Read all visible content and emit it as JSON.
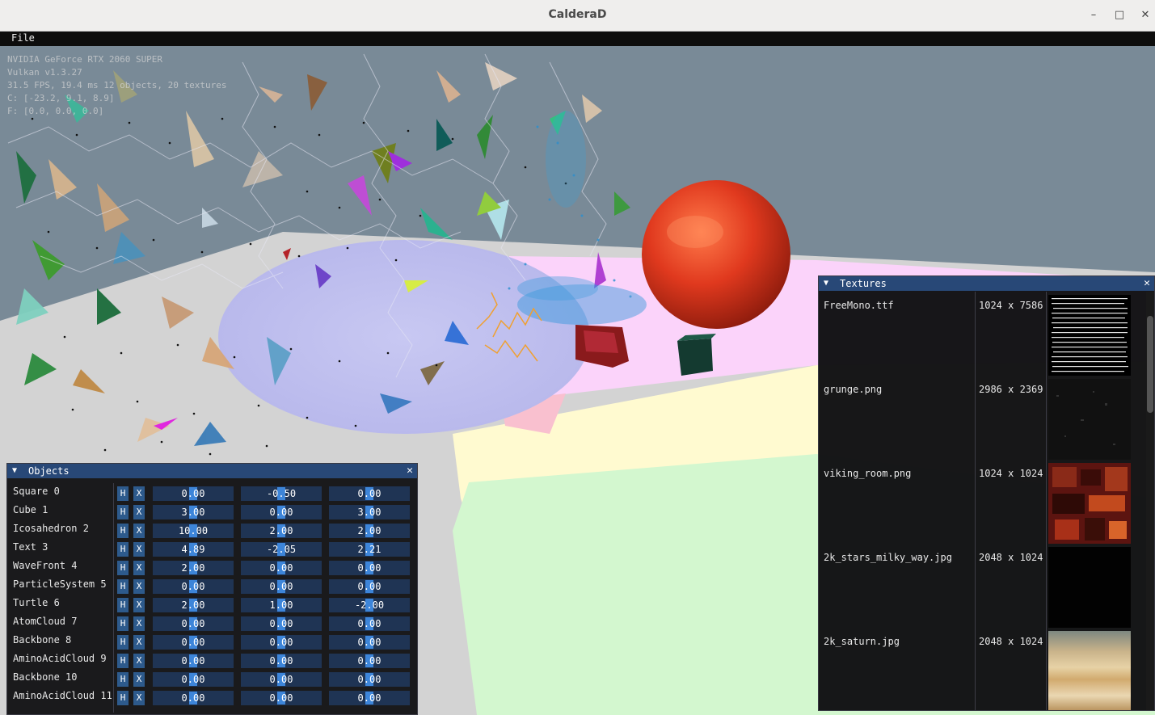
{
  "window": {
    "title": "CalderaD",
    "minimize_glyph": "–",
    "maximize_glyph": "□",
    "close_glyph": "✕"
  },
  "menu": {
    "file_label": "File"
  },
  "overlay": {
    "gpu": "NVIDIA GeForce RTX 2060 SUPER",
    "api": "Vulkan v1.3.27",
    "stats": "31.5 FPS, 19.4 ms 12 objects, 20 textures",
    "camera": "C: [-23.2, 9.1, 8.9]",
    "focus": "F: [0.0, 0.0, 0.0]"
  },
  "objects_panel": {
    "title": "Objects",
    "collapse_glyph": "▼",
    "close_glyph": "✕",
    "hide_label": "H",
    "delete_label": "X",
    "rows": [
      {
        "name": "Square 0",
        "x": "0.00",
        "y": "-0.50",
        "z": "0.00"
      },
      {
        "name": "Cube 1",
        "x": "3.00",
        "y": "0.00",
        "z": "3.00"
      },
      {
        "name": "Icosahedron 2",
        "x": "10.00",
        "y": "2.00",
        "z": "2.00"
      },
      {
        "name": "Text 3",
        "x": "4.89",
        "y": "-2.05",
        "z": "2.21"
      },
      {
        "name": "WaveFront 4",
        "x": "2.00",
        "y": "0.00",
        "z": "0.00"
      },
      {
        "name": "ParticleSystem 5",
        "x": "0.00",
        "y": "0.00",
        "z": "0.00"
      },
      {
        "name": "Turtle 6",
        "x": "2.00",
        "y": "1.00",
        "z": "-2.00"
      },
      {
        "name": "AtomCloud 7",
        "x": "0.00",
        "y": "0.00",
        "z": "0.00"
      },
      {
        "name": "Backbone 8",
        "x": "0.00",
        "y": "0.00",
        "z": "0.00"
      },
      {
        "name": "AminoAcidCloud 9",
        "x": "0.00",
        "y": "0.00",
        "z": "0.00"
      },
      {
        "name": "Backbone 10",
        "x": "0.00",
        "y": "0.00",
        "z": "0.00"
      },
      {
        "name": "AminoAcidCloud 11",
        "x": "0.00",
        "y": "0.00",
        "z": "0.00"
      }
    ]
  },
  "textures_panel": {
    "title": "Textures",
    "collapse_glyph": "▼",
    "close_glyph": "✕",
    "rows": [
      {
        "name": "FreeMono.ttf",
        "size": "1024 x 7586"
      },
      {
        "name": "grunge.png",
        "size": "2986 x 2369"
      },
      {
        "name": "viking_room.png",
        "size": "1024 x 1024"
      },
      {
        "name": "2k_stars_milky_way.jpg",
        "size": "2048 x 1024"
      },
      {
        "name": "2k_saturn.jpg",
        "size": "2048 x 1024"
      }
    ]
  },
  "colors": {
    "sky": "#798a97",
    "accent": "#284877",
    "widget": "#1f3454",
    "sphere": "#e0391e"
  }
}
